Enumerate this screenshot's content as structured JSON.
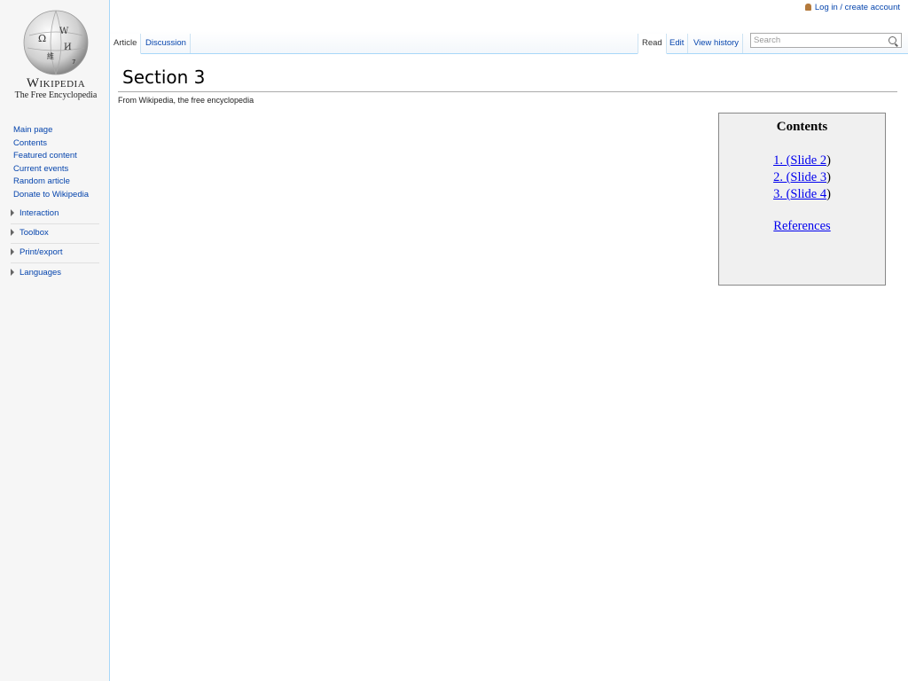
{
  "personal": {
    "login_label": "Log in / create account"
  },
  "logo": {
    "wordmark": "Wikipedia",
    "tagline": "The Free Encyclopedia"
  },
  "sidebar": {
    "nav": [
      "Main page",
      "Contents",
      "Featured content",
      "Current events",
      "Random article",
      "Donate to Wikipedia"
    ],
    "portals": [
      "Interaction",
      "Toolbox",
      "Print/export",
      "Languages"
    ]
  },
  "tabs": {
    "article": "Article",
    "discussion": "Discussion",
    "read": "Read",
    "edit": "Edit",
    "history": "View history"
  },
  "search": {
    "placeholder": "Search"
  },
  "page": {
    "title": "Section 3",
    "tagline": "From Wikipedia, the free encyclopedia"
  },
  "toc": {
    "title": "Contents",
    "items": [
      {
        "link": "1. (Slide 2",
        "suffix": ")"
      },
      {
        "link": "2. (Slide 3",
        "suffix": ")"
      },
      {
        "link": "3. (Slide 4",
        "suffix": ")"
      }
    ],
    "references": "References"
  },
  "colors": {
    "link": "#0645ad",
    "toc_link": "#0000ee",
    "sidebar_bg": "#f6f6f6",
    "tab_border": "#a7d7f9"
  }
}
